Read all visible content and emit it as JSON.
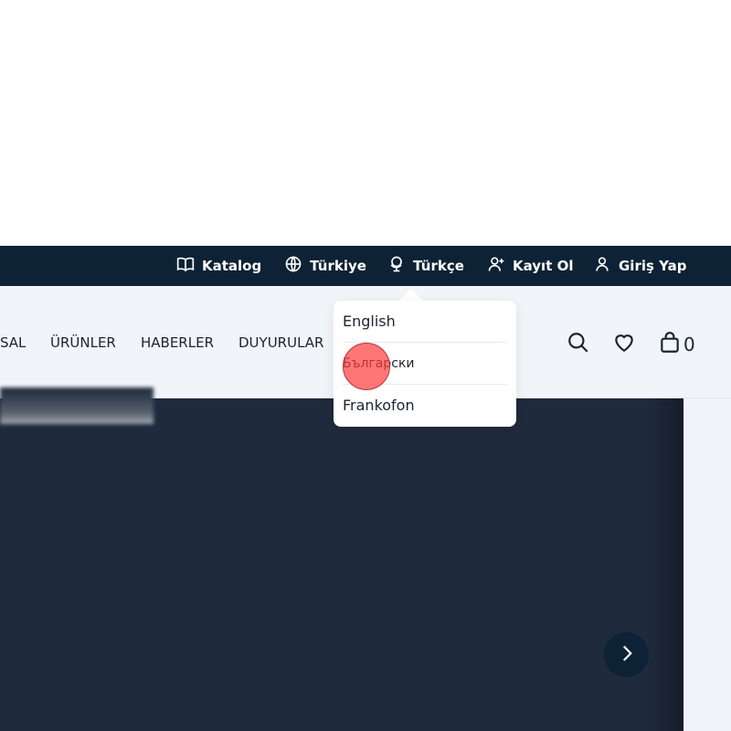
{
  "topbar": {
    "items": [
      {
        "label": "Katalog",
        "icon": "book-icon"
      },
      {
        "label": "Türkiye",
        "icon": "globe-icon"
      },
      {
        "label": "Türkçe",
        "icon": "world-stand-icon"
      },
      {
        "label": "Kayıt Ol",
        "icon": "user-add-icon"
      },
      {
        "label": "Giriş Yap",
        "icon": "user-icon"
      }
    ]
  },
  "nav": {
    "links": [
      "SAL",
      "ÜRÜNLER",
      "HABERLER",
      "DUYURULAR"
    ],
    "cart_count": "0"
  },
  "language_dropdown": {
    "options": [
      "English",
      "Български",
      "Frankofon"
    ]
  },
  "colors": {
    "topbar_bg": "#0d2235",
    "nav_bg": "#f1f4f9",
    "hero_bg": "#1f2a3c",
    "click_marker": "#ff3c3c"
  }
}
